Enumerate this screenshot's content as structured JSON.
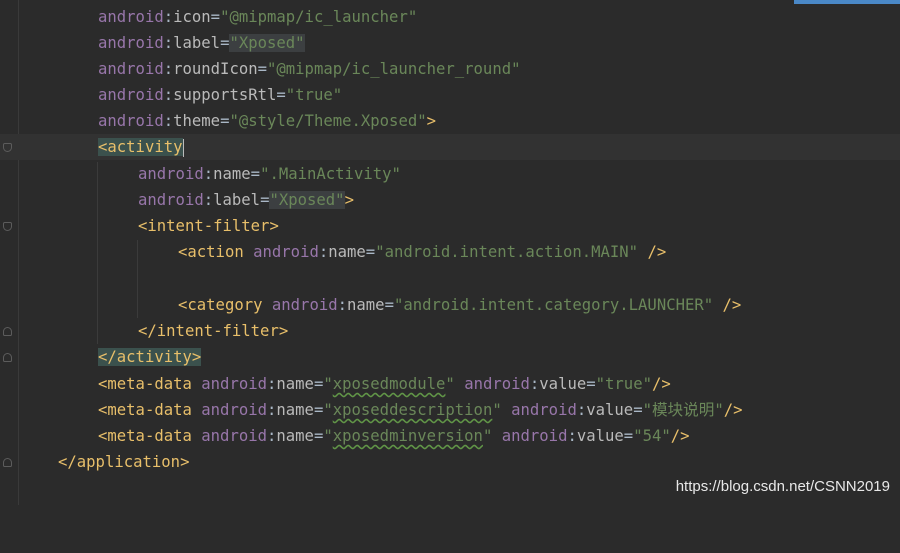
{
  "editor": {
    "language": "xml",
    "lines": [
      [
        "android",
        ":",
        "icon",
        "=",
        "\"@mipmap/ic_launcher\""
      ],
      [
        "android",
        ":",
        "label",
        "=",
        "\"Xposed\""
      ],
      [
        "android",
        ":",
        "roundIcon",
        "=",
        "\"@mipmap/ic_launcher_round\""
      ],
      [
        "android",
        ":",
        "supportsRtl",
        "=",
        "\"true\""
      ],
      [
        "android",
        ":",
        "theme",
        "=",
        "\"@style/Theme.Xposed\"",
        ">"
      ],
      [
        "<",
        "activity"
      ],
      [
        "android",
        ":",
        "name",
        "=",
        "\".MainActivity\""
      ],
      [
        "android",
        ":",
        "label",
        "=",
        "\"Xposed\"",
        ">"
      ],
      [
        "<",
        "intent-filter",
        ">"
      ],
      [
        "<",
        "action",
        " ",
        "android",
        ":",
        "name",
        "=",
        "\"android.intent.action.MAIN\"",
        " ",
        "/>"
      ],
      [],
      [
        "<",
        "category",
        " ",
        "android",
        ":",
        "name",
        "=",
        "\"android.intent.category.LAUNCHER\"",
        " ",
        "/>"
      ],
      [
        "</",
        "intent-filter",
        ">"
      ],
      [
        "</",
        "activity",
        ">"
      ],
      [
        "<",
        "meta-data",
        " ",
        "android",
        ":",
        "name",
        "=",
        "\"",
        "xposedmodule",
        "\"",
        " ",
        "android",
        ":",
        "value",
        "=",
        "\"true\"",
        "/>"
      ],
      [
        "<",
        "meta-data",
        " ",
        "android",
        ":",
        "name",
        "=",
        "\"",
        "xposeddescription",
        "\"",
        " ",
        "android",
        ":",
        "value",
        "=",
        "\"模块说明\"",
        "/>"
      ],
      [
        "<",
        "meta-data",
        " ",
        "android",
        ":",
        "name",
        "=",
        "\"",
        "xposedminversion",
        "\"",
        " ",
        "android",
        ":",
        "value",
        "=",
        "\"54\"",
        "/>"
      ],
      [
        "</",
        "application",
        ">"
      ]
    ]
  },
  "watermark": {
    "text": "https://blog.csdn.net/CSNN2019"
  },
  "colors": {
    "background": "#2b2b2b",
    "tag": "#e8bf6a",
    "namespace": "#9876aa",
    "attribute": "#bababa",
    "string": "#6a8759",
    "text": "#a9b7c6",
    "selection_accent": "#4a88c7"
  }
}
